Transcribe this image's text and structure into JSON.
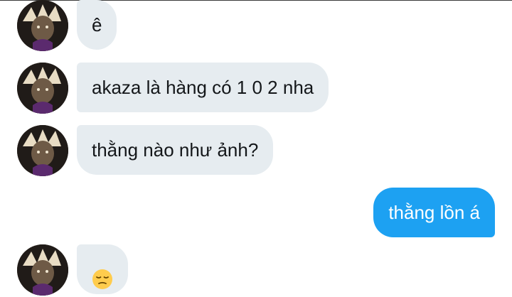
{
  "messages": [
    {
      "direction": "received",
      "text": "ê"
    },
    {
      "direction": "received",
      "text": "akaza là hàng có 1 0 2 nha"
    },
    {
      "direction": "received",
      "text": "thằng nào như ảnh?"
    },
    {
      "direction": "sent",
      "text": "thằng lồn á"
    },
    {
      "direction": "received",
      "emoji": "pensive-face"
    }
  ],
  "colors": {
    "received_bubble": "#e6ecf0",
    "sent_bubble": "#1da1f2",
    "received_text": "#14171a",
    "sent_text": "#ffffff"
  }
}
